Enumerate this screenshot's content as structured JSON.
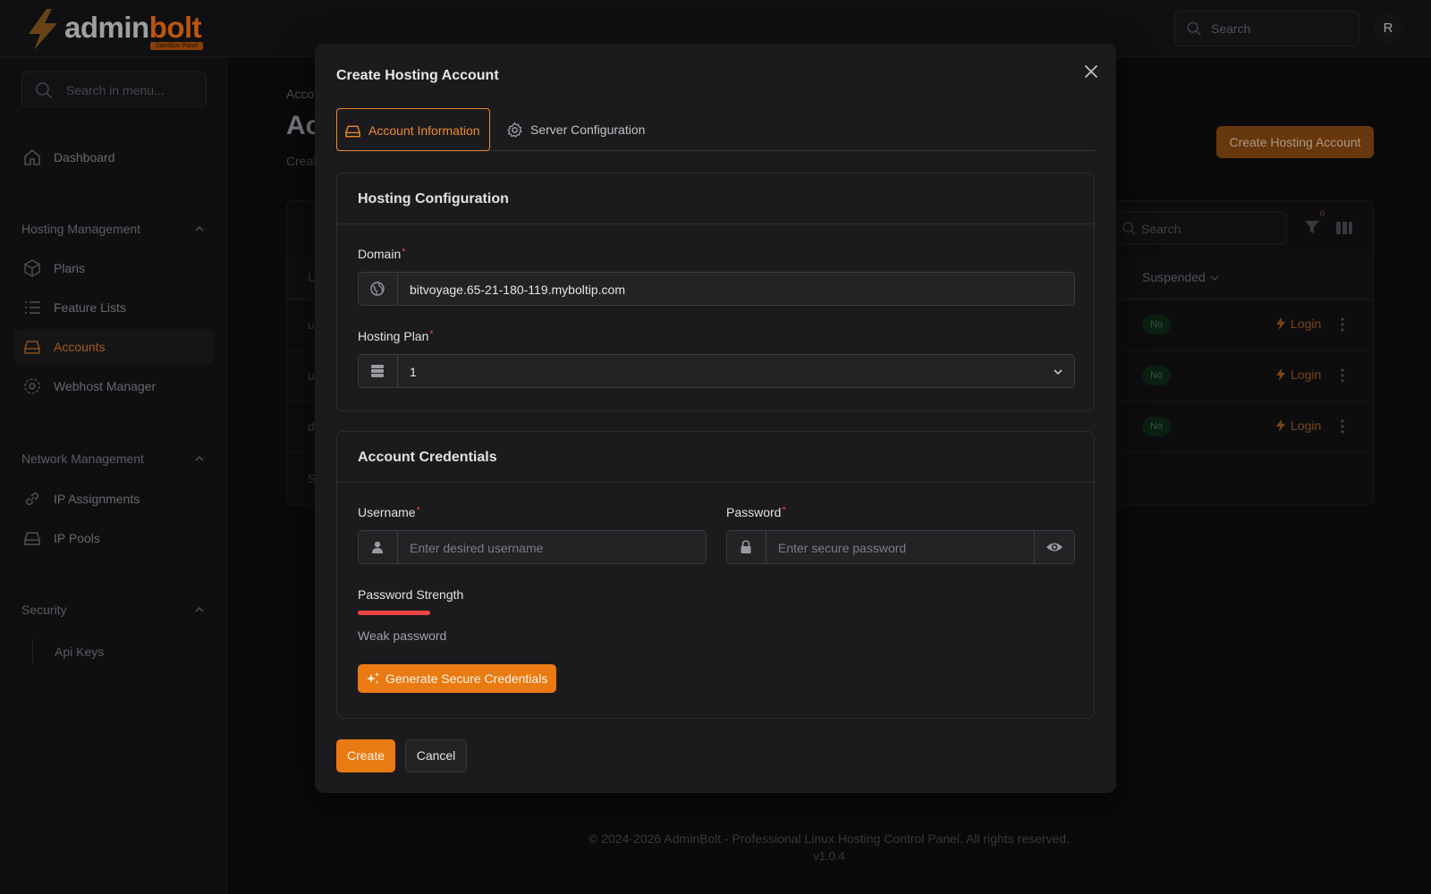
{
  "brand": {
    "name_part1": "admin",
    "name_part2": "bolt",
    "tag": "Sandbox Panel"
  },
  "topbar": {
    "search_placeholder": "Search",
    "avatar_initial": "R"
  },
  "sidebar": {
    "search_placeholder": "Search in menu...",
    "dashboard": "Dashboard",
    "groups": [
      {
        "label": "Hosting Management",
        "items": [
          "Plans",
          "Feature Lists",
          "Accounts",
          "Webhost Manager"
        ]
      },
      {
        "label": "Network Management",
        "items": [
          "IP Assignments",
          "IP Pools"
        ]
      },
      {
        "label": "Security",
        "items": [
          "Api Keys"
        ]
      }
    ],
    "active_item": "Accounts"
  },
  "background_page": {
    "breadcrumb": "Acco",
    "title": "Ac",
    "subtitle": "Creat",
    "create_button": "Create Hosting Account",
    "table_search_placeholder": "Search",
    "filter_count": "0",
    "column_first_initial": "U",
    "column_suspended": "Suspended",
    "rows": [
      {
        "first": "u",
        "suspended": "No",
        "action": "Login"
      },
      {
        "first": "u",
        "suspended": "No",
        "action": "Login"
      },
      {
        "first": "d",
        "suspended": "No",
        "action": "Login"
      }
    ],
    "footer_first": "S"
  },
  "footer": {
    "copyright": "© 2024-2026 AdminBolt - Professional Linux Hosting Control Panel. All rights reserved.",
    "version": "v1.0.4"
  },
  "modal": {
    "title": "Create Hosting Account",
    "tabs": [
      {
        "label": "Account Information",
        "icon": "drive-icon",
        "active": true
      },
      {
        "label": "Server Configuration",
        "icon": "gear-icon",
        "active": false
      }
    ],
    "hosting_config": {
      "heading": "Hosting Configuration",
      "domain_label": "Domain",
      "domain_value": "bitvoyage.65-21-180-119.myboltip.com",
      "plan_label": "Hosting Plan",
      "plan_value": "1"
    },
    "credentials": {
      "heading": "Account Credentials",
      "username_label": "Username",
      "username_placeholder": "Enter desired username",
      "password_label": "Password",
      "password_placeholder": "Enter secure password",
      "strength_label": "Password Strength",
      "strength_text": "Weak password",
      "strength_fraction": 0.2,
      "generate_button": "Generate Secure Credentials"
    },
    "create_button": "Create",
    "cancel_button": "Cancel"
  },
  "colors": {
    "accent": "#ea7a12",
    "danger": "#ef4444",
    "modal_bg": "#1b1b1d",
    "page_bg": "#0e0e10"
  }
}
